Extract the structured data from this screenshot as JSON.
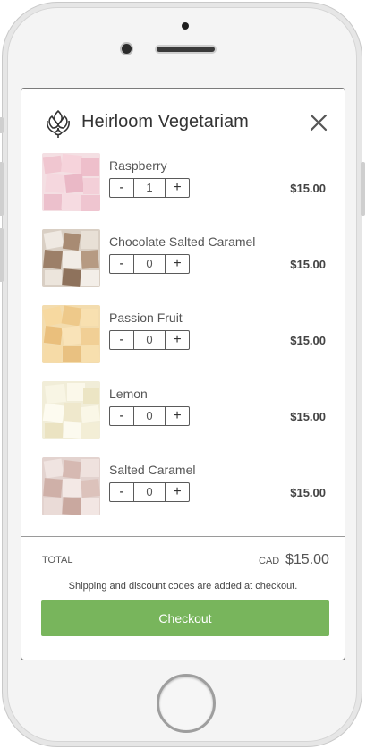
{
  "header": {
    "store_name": "Heirloom Vegetariam"
  },
  "cart": {
    "items": [
      {
        "name": "Raspberry",
        "quantity": "1",
        "price": "$15.00",
        "decrement_label": "-",
        "increment_label": "+"
      },
      {
        "name": "Chocolate Salted Caramel",
        "quantity": "0",
        "price": "$15.00",
        "decrement_label": "-",
        "increment_label": "+"
      },
      {
        "name": "Passion Fruit",
        "quantity": "0",
        "price": "$15.00",
        "decrement_label": "-",
        "increment_label": "+"
      },
      {
        "name": "Lemon",
        "quantity": "0",
        "price": "$15.00",
        "decrement_label": "-",
        "increment_label": "+"
      },
      {
        "name": "Salted Caramel",
        "quantity": "0",
        "price": "$15.00",
        "decrement_label": "-",
        "increment_label": "+"
      }
    ]
  },
  "footer": {
    "total_label": "TOTAL",
    "currency": "CAD",
    "total_value": "$15.00",
    "note": "Shipping and discount codes are added at checkout.",
    "checkout_label": "Checkout"
  },
  "icons": {
    "logo": "artichoke-logo-icon",
    "close": "close-icon"
  },
  "colors": {
    "checkout_button": "#78b55c",
    "text_primary": "#333333",
    "text_secondary": "#555555"
  }
}
